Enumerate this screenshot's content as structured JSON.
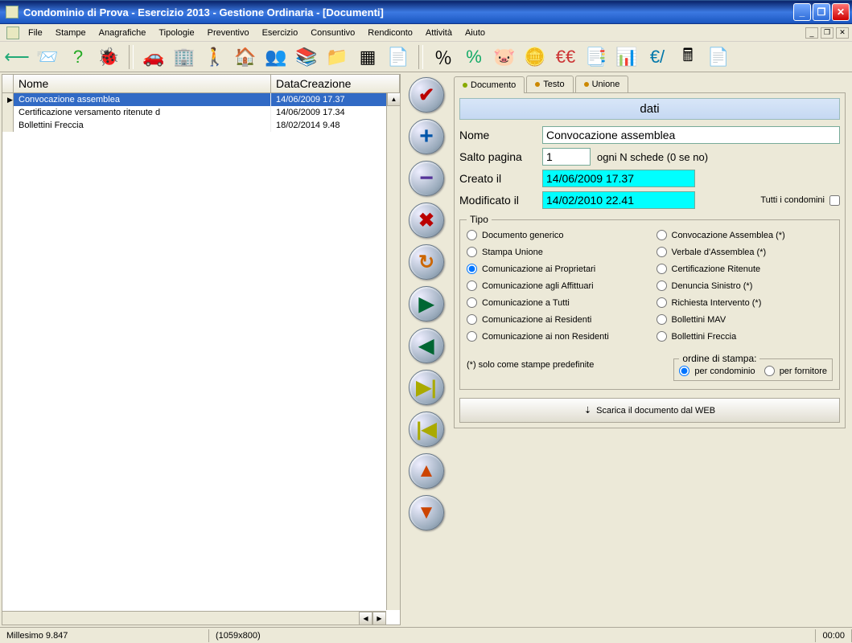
{
  "title": "Condominio di Prova - Esercizio 2013 - Gestione Ordinaria - [Documenti]",
  "menu": [
    "File",
    "Stampe",
    "Anagrafiche",
    "Tipologie",
    "Preventivo",
    "Esercizio",
    "Consuntivo",
    "Rendiconto",
    "Attività",
    "Aiuto"
  ],
  "table": {
    "headers": {
      "c1": "Nome",
      "c2": "DataCreazione"
    },
    "rows": [
      {
        "nome": "Convocazione assemblea",
        "data": "14/06/2009 17.37",
        "selected": true
      },
      {
        "nome": "Certificazione versamento ritenute d",
        "data": "14/06/2009 17.34",
        "selected": false
      },
      {
        "nome": "Bollettini Freccia",
        "data": "18/02/2014 9.48",
        "selected": false
      }
    ]
  },
  "tabs": {
    "t1": "Documento",
    "t2": "Testo",
    "t3": "Unione"
  },
  "form": {
    "section": "dati",
    "nome_lbl": "Nome",
    "nome_val": "Convocazione assemblea",
    "salto_lbl": "Salto pagina",
    "salto_val": "1",
    "salto_suffix": "ogni N schede (0 se no)",
    "creato_lbl": "Creato il",
    "creato_val": "14/06/2009 17.37",
    "modif_lbl": "Modificato il",
    "modif_val": "14/02/2010 22.41",
    "tutti_lbl": "Tutti i condomini",
    "tipo_legend": "Tipo",
    "radios": [
      "Documento generico",
      "Convocazione Assemblea (*)",
      "Stampa Unione",
      "Verbale d'Assemblea (*)",
      "Comunicazione ai Proprietari",
      "Certificazione Ritenute",
      "Comunicazione agli Affittuari",
      "Denuncia Sinistro (*)",
      "Comunicazione a Tutti",
      "Richiesta Intervento (*)",
      "Comunicazione ai Residenti",
      "Bollettini MAV",
      "Comunicazione ai non Residenti",
      "Bollettini Freccia"
    ],
    "radio_selected": 4,
    "note": "(*) solo come stampe predefinite",
    "ordine_legend": "ordine di stampa:",
    "ordine_opts": [
      "per condominio",
      "per fornitore"
    ],
    "download_btn": "Scarica il documento dal WEB"
  },
  "status": {
    "app": "Millesimo 9.847",
    "res": "(1059x800)",
    "time": "00:00"
  }
}
